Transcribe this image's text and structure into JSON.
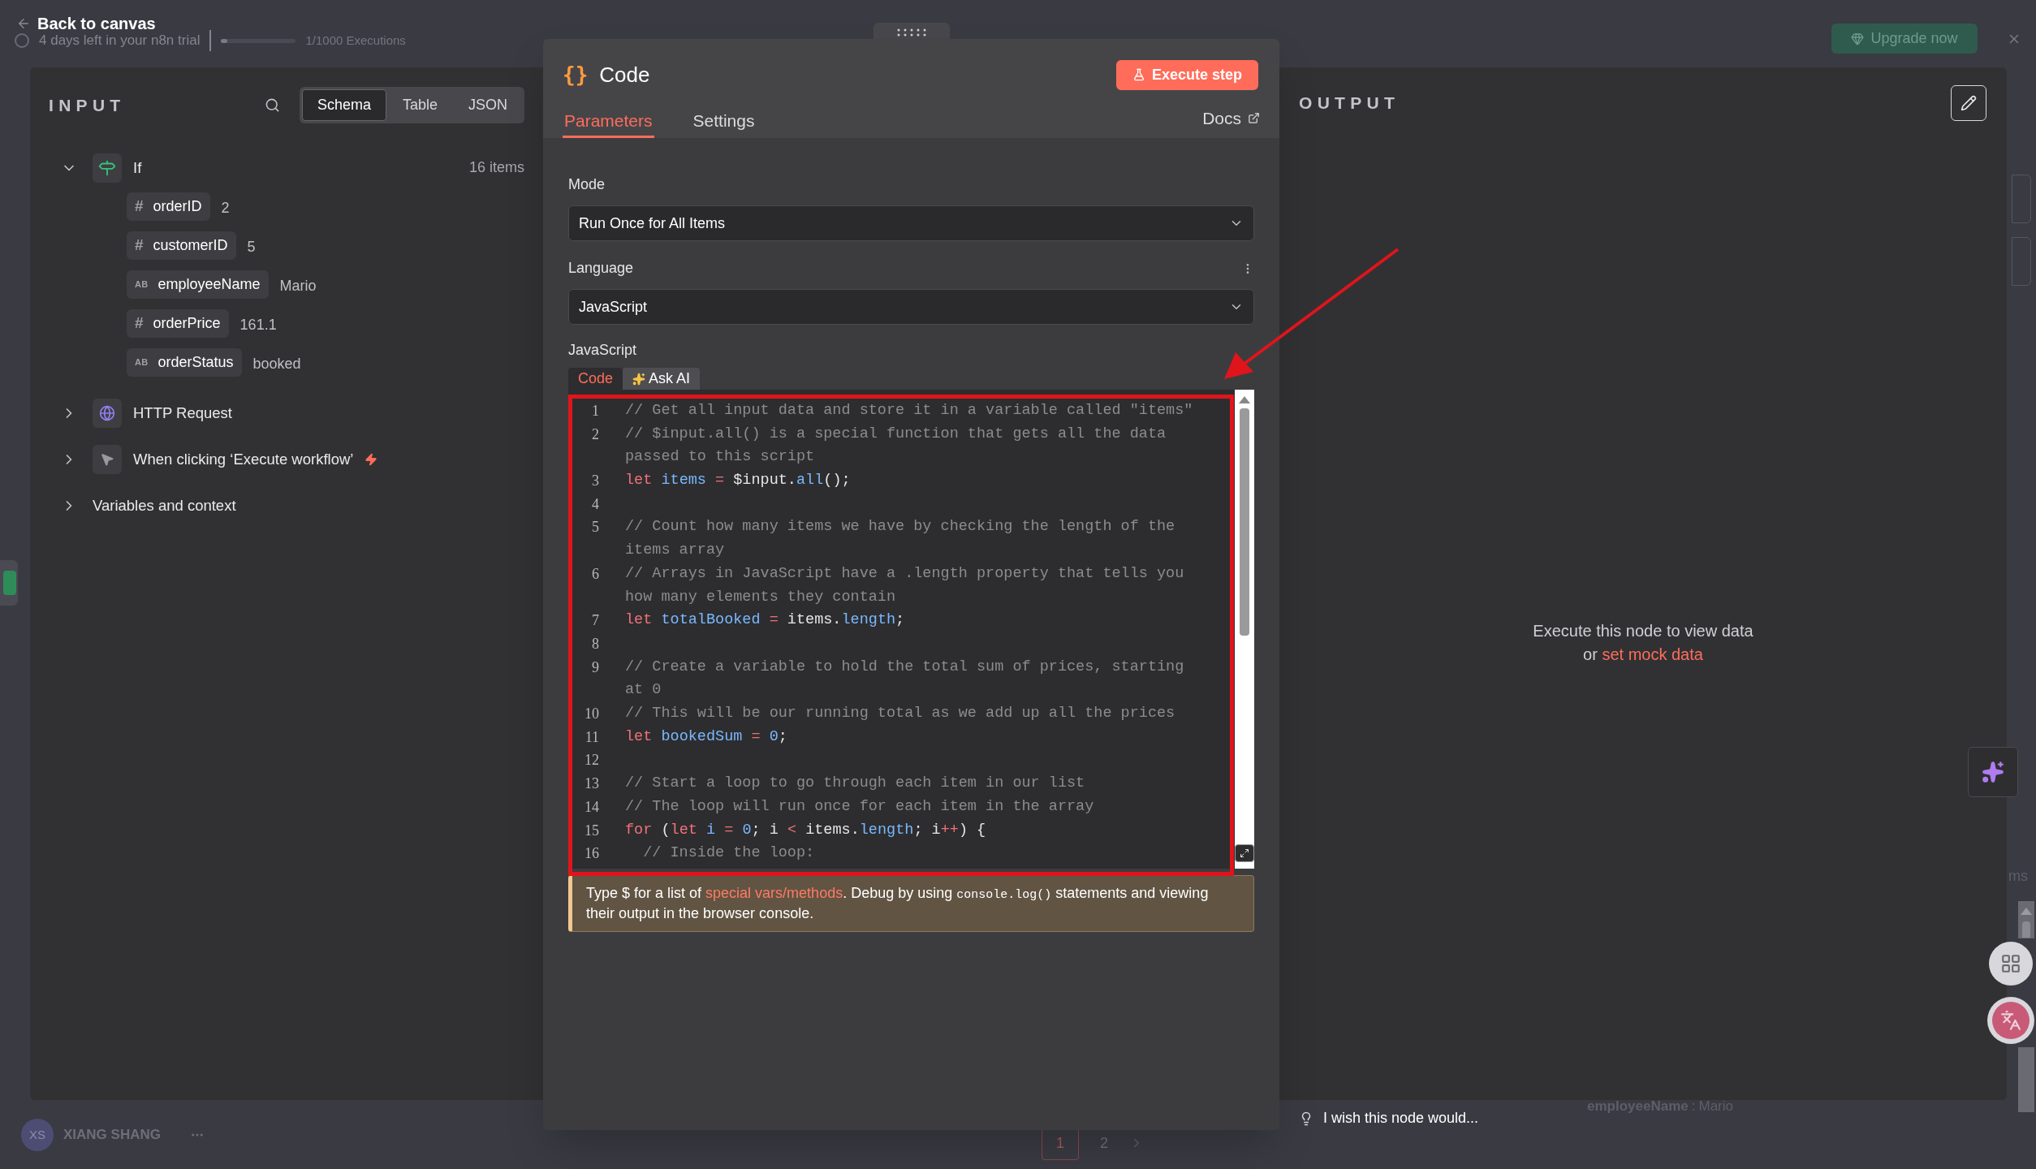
{
  "background": {
    "back_link": "Back to canvas",
    "trial_notice": "4 days left in your n8n trial",
    "executions": "1/1000 Executions",
    "executions_progress": {
      "level": 0.08
    },
    "upgrade_button": "Upgrade now",
    "user": {
      "initials": "XS",
      "name": "XIANG SHANG"
    },
    "pagination": [
      {
        "label": "1",
        "selected": true
      },
      {
        "label": "2",
        "selected": false
      }
    ],
    "faint_field": {
      "name": "employeeName",
      "separator": ":",
      "value": "Mario"
    },
    "side_fragment": "ms"
  },
  "input_panel": {
    "title": "INPUT",
    "view_tabs": [
      {
        "label": "Schema",
        "selected": true
      },
      {
        "label": "Table",
        "selected": false
      },
      {
        "label": "JSON",
        "selected": false
      }
    ],
    "tree": [
      {
        "kind": "if",
        "label": "If",
        "count": "16 items",
        "expanded": true,
        "children": [
          {
            "type_mark": "#",
            "name": "orderID",
            "value": "2"
          },
          {
            "type_mark": "#",
            "name": "customerID",
            "value": "5"
          },
          {
            "type_mark": "AB",
            "name": "employeeName",
            "value": "Mario"
          },
          {
            "type_mark": "#",
            "name": "orderPrice",
            "value": "161.1"
          },
          {
            "type_mark": "AB",
            "name": "orderStatus",
            "value": "booked"
          }
        ]
      },
      {
        "kind": "http",
        "label": "HTTP Request",
        "expanded": false
      },
      {
        "kind": "trigger",
        "label": "When clicking ‘Execute workflow’",
        "expanded": false
      },
      {
        "kind": "plain",
        "label": "Variables and context",
        "expanded": false
      }
    ]
  },
  "node_dialog": {
    "icon_text": "{}",
    "title": "Code",
    "execute_button": "Execute step",
    "tabs": [
      {
        "label": "Parameters",
        "selected": true
      },
      {
        "label": "Settings",
        "selected": false
      }
    ],
    "docs_link": "Docs",
    "mode": {
      "label": "Mode",
      "value": "Run Once for All Items"
    },
    "language": {
      "label": "Language",
      "value": "JavaScript"
    },
    "editor": {
      "label": "JavaScript",
      "tabs": [
        {
          "label": "Code",
          "selected": true
        },
        {
          "label": "Ask AI",
          "selected": false
        }
      ],
      "lines": [
        {
          "number": "1",
          "rows": [
            [
              {
                "kind": "comment",
                "text": "// Get all input data and store it in a variable called \"items\""
              }
            ]
          ]
        },
        {
          "number": "2",
          "rows": [
            [
              {
                "kind": "comment",
                "text": "// $input.all() is a special function that gets all the data"
              }
            ],
            [
              {
                "kind": "comment",
                "text": "passed to this script"
              }
            ]
          ]
        },
        {
          "number": "3",
          "rows": [
            [
              {
                "kind": "keyword",
                "text": "let "
              },
              {
                "kind": "name",
                "text": "items"
              },
              {
                "kind": "operator",
                "text": " = "
              },
              {
                "kind": "plain",
                "text": "$input."
              },
              {
                "kind": "name",
                "text": "all"
              },
              {
                "kind": "plain",
                "text": "();"
              }
            ]
          ]
        },
        {
          "number": "4",
          "rows": [
            []
          ]
        },
        {
          "number": "5",
          "rows": [
            [
              {
                "kind": "comment",
                "text": "// Count how many items we have by checking the length of the"
              }
            ],
            [
              {
                "kind": "comment",
                "text": "items array"
              }
            ]
          ]
        },
        {
          "number": "6",
          "rows": [
            [
              {
                "kind": "comment",
                "text": "// Arrays in JavaScript have a .length property that tells you"
              }
            ],
            [
              {
                "kind": "comment",
                "text": "how many elements they contain"
              }
            ]
          ]
        },
        {
          "number": "7",
          "rows": [
            [
              {
                "kind": "keyword",
                "text": "let "
              },
              {
                "kind": "name",
                "text": "totalBooked"
              },
              {
                "kind": "operator",
                "text": " = "
              },
              {
                "kind": "plain",
                "text": "items."
              },
              {
                "kind": "name",
                "text": "length"
              },
              {
                "kind": "plain",
                "text": ";"
              }
            ]
          ]
        },
        {
          "number": "8",
          "rows": [
            []
          ]
        },
        {
          "number": "9",
          "rows": [
            [
              {
                "kind": "comment",
                "text": "// Create a variable to hold the total sum of prices, starting"
              }
            ],
            [
              {
                "kind": "comment",
                "text": "at 0"
              }
            ]
          ]
        },
        {
          "number": "10",
          "rows": [
            [
              {
                "kind": "comment",
                "text": "// This will be our running total as we add up all the prices"
              }
            ]
          ]
        },
        {
          "number": "11",
          "rows": [
            [
              {
                "kind": "keyword",
                "text": "let "
              },
              {
                "kind": "name",
                "text": "bookedSum"
              },
              {
                "kind": "operator",
                "text": " = "
              },
              {
                "kind": "name",
                "text": "0"
              },
              {
                "kind": "plain",
                "text": ";"
              }
            ]
          ]
        },
        {
          "number": "12",
          "rows": [
            []
          ]
        },
        {
          "number": "13",
          "rows": [
            [
              {
                "kind": "comment",
                "text": "// Start a loop to go through each item in our list"
              }
            ]
          ]
        },
        {
          "number": "14",
          "rows": [
            [
              {
                "kind": "comment",
                "text": "// The loop will run once for each item in the array"
              }
            ]
          ]
        },
        {
          "number": "15",
          "rows": [
            [
              {
                "kind": "keyword",
                "text": "for "
              },
              {
                "kind": "plain",
                "text": "("
              },
              {
                "kind": "keyword",
                "text": "let "
              },
              {
                "kind": "name",
                "text": "i"
              },
              {
                "kind": "operator",
                "text": " = "
              },
              {
                "kind": "name",
                "text": "0"
              },
              {
                "kind": "plain",
                "text": "; i "
              },
              {
                "kind": "operator",
                "text": "< "
              },
              {
                "kind": "plain",
                "text": "items."
              },
              {
                "kind": "name",
                "text": "length"
              },
              {
                "kind": "plain",
                "text": "; i"
              },
              {
                "kind": "operator",
                "text": "++"
              },
              {
                "kind": "plain",
                "text": ") {"
              }
            ]
          ]
        },
        {
          "number": "16",
          "rows": [
            [
              {
                "kind": "comment",
                "text": "  // Inside the loop:"
              }
            ]
          ]
        }
      ]
    },
    "hint": {
      "before": "Type $ for a list of ",
      "link": "special vars/methods",
      "middle": ". Debug by using ",
      "code": "console.log()",
      "after": " statements and viewing their output in the browser console."
    }
  },
  "output_panel": {
    "title": "OUTPUT",
    "empty_text": "Execute this node to view data",
    "or": "or ",
    "mock_link": "set mock data"
  },
  "feedback": "I wish this node would..."
}
